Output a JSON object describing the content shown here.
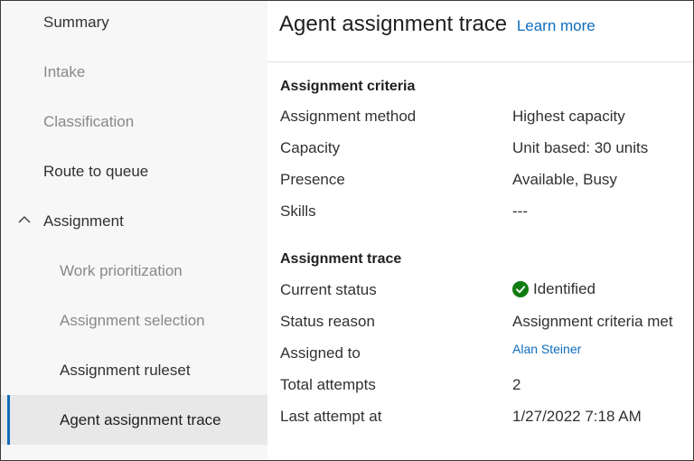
{
  "sidebar": {
    "items": [
      {
        "label": "Summary",
        "state": "enabled"
      },
      {
        "label": "Intake",
        "state": "disabled"
      },
      {
        "label": "Classification",
        "state": "disabled"
      },
      {
        "label": "Route to queue",
        "state": "enabled"
      },
      {
        "label": "Assignment",
        "state": "enabled",
        "expanded": true
      },
      {
        "label": "Work prioritization",
        "state": "disabled"
      },
      {
        "label": "Assignment selection",
        "state": "disabled"
      },
      {
        "label": "Assignment ruleset",
        "state": "enabled"
      },
      {
        "label": "Agent assignment trace",
        "state": "selected"
      }
    ]
  },
  "main": {
    "title": "Agent assignment trace",
    "learn_more": "Learn more",
    "criteria": {
      "heading": "Assignment criteria",
      "rows": [
        {
          "label": "Assignment method",
          "value": "Highest capacity"
        },
        {
          "label": "Capacity",
          "value": "Unit based: 30 units"
        },
        {
          "label": "Presence",
          "value": "Available, Busy"
        },
        {
          "label": "Skills",
          "value": "---"
        }
      ]
    },
    "trace": {
      "heading": "Assignment trace",
      "current_status_label": "Current status",
      "current_status_value": "Identified",
      "status_reason_label": "Status reason",
      "status_reason_value": "Assignment criteria met",
      "assigned_to_label": "Assigned to",
      "assigned_to_value": "Alan Steiner",
      "total_attempts_label": "Total attempts",
      "total_attempts_value": "2",
      "last_attempt_label": "Last attempt at",
      "last_attempt_value": "1/27/2022 7:18 AM"
    }
  },
  "colors": {
    "accent": "#0f6cbd",
    "success": "#107c10",
    "sidebar_bg": "#f7f7f7",
    "selected_bg": "#e8e8e8"
  },
  "icons": {
    "chevron": "chevron-up-icon",
    "status": "checkmark-circle-icon"
  }
}
